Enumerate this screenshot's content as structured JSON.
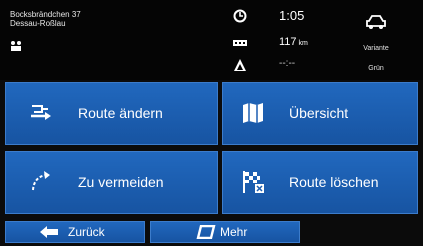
{
  "header": {
    "address_line1": "Bocksbrändchen 37",
    "address_line2": "Dessau-Roßlau",
    "time": "1:05",
    "distance": "117",
    "distance_unit": "km",
    "eta": "--:--",
    "variant_label": "Variante",
    "variant_value": "Grün"
  },
  "menu": {
    "change_route_label": "Route ändern",
    "overview_label": "Übersicht",
    "avoid_label": "Zu vermeiden",
    "delete_route_label": "Route löschen"
  },
  "footer": {
    "back_label": "Zurück",
    "more_label": "Mehr"
  },
  "colors": {
    "button_blue": "#1d5fb2",
    "background": "#0b0b0b"
  },
  "icons": [
    "poi-icon",
    "clock-icon",
    "route-distance-icon",
    "triangle-icon",
    "car-icon",
    "route-change-icon",
    "map-icon",
    "avoid-icon",
    "flag-delete-icon",
    "back-arrow-icon",
    "more-icon"
  ]
}
